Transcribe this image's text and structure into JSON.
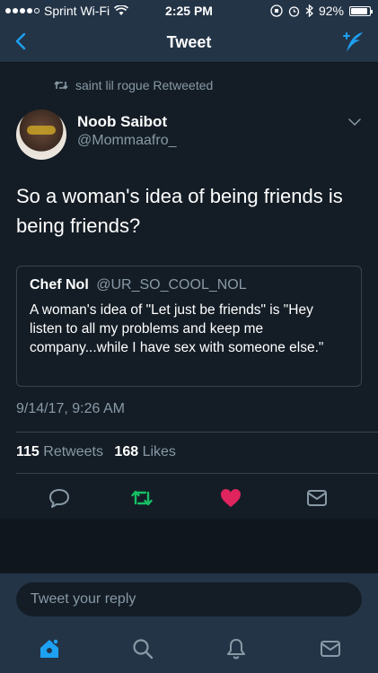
{
  "status_bar": {
    "carrier": "Sprint Wi-Fi",
    "time": "2:25 PM",
    "battery": "92%",
    "battery_level": 0.92
  },
  "nav": {
    "title": "Tweet",
    "back_icon": "chevron-left-icon",
    "compose_icon": "compose-tweet-icon"
  },
  "retweet_context": {
    "text": "saint lil rogue Retweeted"
  },
  "tweet": {
    "author_name": "Noob Saibot",
    "author_handle": "@Mommaafro_",
    "text": "So a woman's idea of being friends is being friends?",
    "timestamp": "9/14/17, 9:26 AM",
    "retweets_count": "115",
    "retweets_label": "Retweets",
    "likes_count": "168",
    "likes_label": "Likes"
  },
  "quoted_tweet": {
    "author_name": "Chef Nol",
    "author_handle": "@UR_SO_COOL_NOL",
    "text": "A woman's idea of \"Let just be friends\" is \"Hey listen to all my problems and keep me company...while I have sex with someone else.\""
  },
  "reply": {
    "placeholder": "Tweet your reply"
  },
  "colors": {
    "accent": "#1da1f2",
    "retweet": "#17bf63",
    "like": "#e0245e",
    "background": "#141d26",
    "bar": "#243447",
    "secondary_text": "#8899a6"
  }
}
